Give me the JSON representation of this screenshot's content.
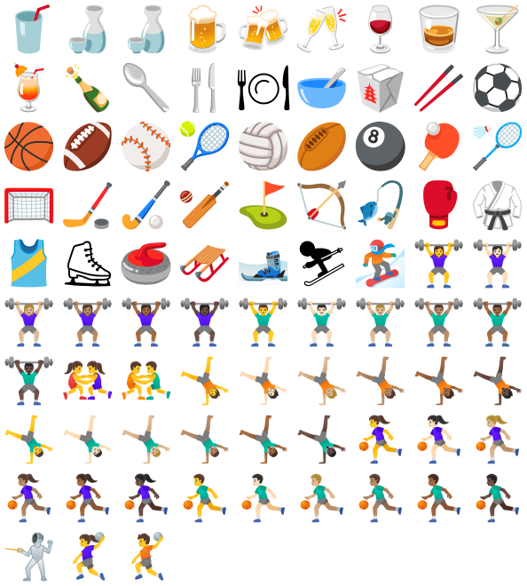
{
  "emojis": [
    {
      "name": "cup-with-straw-icon",
      "glyph": "🥤"
    },
    {
      "name": "sake-cup-icon",
      "glyph": "🍶"
    },
    {
      "name": "sake-bottle-icon",
      "glyph": "🍶"
    },
    {
      "name": "beer-mug-icon",
      "glyph": "🍺"
    },
    {
      "name": "clinking-beer-mugs-icon",
      "glyph": "🍻"
    },
    {
      "name": "clinking-glasses-icon",
      "glyph": "🥂"
    },
    {
      "name": "wine-glass-icon",
      "glyph": "🍷"
    },
    {
      "name": "tumbler-glass-icon",
      "glyph": "🥃"
    },
    {
      "name": "cocktail-glass-icon",
      "glyph": "🍸"
    },
    {
      "name": "tropical-drink-icon",
      "glyph": "🍹"
    },
    {
      "name": "champagne-bottle-icon",
      "glyph": "🍾"
    },
    {
      "name": "spoon-icon",
      "glyph": "🥄"
    },
    {
      "name": "fork-and-knife-icon",
      "glyph": "🍴"
    },
    {
      "name": "fork-and-knife-with-plate-icon",
      "glyph": "🍽"
    },
    {
      "name": "bowl-with-soup-icon",
      "glyph": "🥣"
    },
    {
      "name": "takeout-box-icon",
      "glyph": "🥡"
    },
    {
      "name": "chopsticks-icon",
      "glyph": "🥢"
    },
    {
      "name": "soccer-ball-icon",
      "glyph": "⚽"
    },
    {
      "name": "basketball-icon",
      "glyph": "🏀"
    },
    {
      "name": "american-football-icon",
      "glyph": "🏈"
    },
    {
      "name": "baseball-icon",
      "glyph": "⚾"
    },
    {
      "name": "tennis-icon",
      "glyph": "🎾"
    },
    {
      "name": "volleyball-icon",
      "glyph": "🏐"
    },
    {
      "name": "rugby-football-icon",
      "glyph": "🏉"
    },
    {
      "name": "pool-8-ball-icon",
      "glyph": "🎱"
    },
    {
      "name": "ping-pong-icon",
      "glyph": "🏓"
    },
    {
      "name": "badminton-icon",
      "glyph": "🏸"
    },
    {
      "name": "goal-net-icon",
      "glyph": "🥅"
    },
    {
      "name": "ice-hockey-icon",
      "glyph": "🏒"
    },
    {
      "name": "field-hockey-icon",
      "glyph": "🏑"
    },
    {
      "name": "cricket-game-icon",
      "glyph": "🏏"
    },
    {
      "name": "flag-in-hole-icon",
      "glyph": "⛳"
    },
    {
      "name": "bow-and-arrow-icon",
      "glyph": "🏹"
    },
    {
      "name": "fishing-pole-icon",
      "glyph": "🎣"
    },
    {
      "name": "boxing-glove-icon",
      "glyph": "🥊"
    },
    {
      "name": "martial-arts-uniform-icon",
      "glyph": "🥋"
    },
    {
      "name": "running-shirt-icon",
      "glyph": "🎽"
    },
    {
      "name": "ice-skate-icon",
      "glyph": "⛸"
    },
    {
      "name": "curling-stone-icon",
      "glyph": "🥌"
    },
    {
      "name": "sled-icon",
      "glyph": "🛷"
    },
    {
      "name": "skis-icon",
      "glyph": "🎿"
    },
    {
      "name": "skier-icon",
      "glyph": "⛷"
    },
    {
      "name": "snowboarder-icon",
      "glyph": "🏂"
    },
    {
      "name": "woman-lifting-weights-icon",
      "glyph": "🏋️‍♀️"
    },
    {
      "name": "woman-lifting-weights-light-skin-icon",
      "glyph": "🏋🏻‍♀️"
    },
    {
      "name": "woman-lifting-weights-medium-light-skin-icon",
      "glyph": "🏋🏼‍♀️"
    },
    {
      "name": "woman-lifting-weights-medium-skin-icon",
      "glyph": "🏋🏽‍♀️"
    },
    {
      "name": "woman-lifting-weights-medium-dark-skin-icon",
      "glyph": "🏋🏾‍♀️"
    },
    {
      "name": "woman-lifting-weights-dark-skin-icon",
      "glyph": "🏋🏿‍♀️"
    },
    {
      "name": "man-lifting-weights-icon",
      "glyph": "🏋️‍♂️"
    },
    {
      "name": "man-lifting-weights-light-skin-icon",
      "glyph": "🏋🏻‍♂️"
    },
    {
      "name": "man-lifting-weights-medium-light-skin-icon",
      "glyph": "🏋🏼‍♂️"
    },
    {
      "name": "man-lifting-weights-medium-skin-icon",
      "glyph": "🏋🏽‍♂️"
    },
    {
      "name": "man-lifting-weights-medium-dark-skin-icon",
      "glyph": "🏋🏾‍♂️"
    },
    {
      "name": "man-lifting-weights-dark-skin-icon",
      "glyph": "🏋🏿‍♂️"
    },
    {
      "name": "women-wrestling-icon",
      "glyph": "🤼‍♀️"
    },
    {
      "name": "men-wrestling-icon",
      "glyph": "🤼‍♂️"
    },
    {
      "name": "person-cartwheeling-icon",
      "glyph": "🤸"
    },
    {
      "name": "person-cartwheeling-light-skin-icon",
      "glyph": "🤸🏻"
    },
    {
      "name": "person-cartwheeling-medium-light-skin-icon",
      "glyph": "🤸🏼"
    },
    {
      "name": "person-cartwheeling-medium-skin-icon",
      "glyph": "🤸🏽"
    },
    {
      "name": "person-cartwheeling-medium-dark-skin-icon",
      "glyph": "🤸🏾"
    },
    {
      "name": "person-cartwheeling-dark-skin-icon",
      "glyph": "🤸🏿"
    },
    {
      "name": "man-cartwheeling-icon",
      "glyph": "🤸‍♂️"
    },
    {
      "name": "man-cartwheeling-light-skin-icon",
      "glyph": "🤸🏻‍♂️"
    },
    {
      "name": "man-cartwheeling-medium-light-skin-icon",
      "glyph": "🤸🏼‍♂️"
    },
    {
      "name": "man-cartwheeling-medium-skin-icon",
      "glyph": "🤸🏽‍♂️"
    },
    {
      "name": "man-cartwheeling-medium-dark-skin-icon",
      "glyph": "🤸🏾‍♂️"
    },
    {
      "name": "man-cartwheeling-dark-skin-icon",
      "glyph": "🤸🏿‍♂️"
    },
    {
      "name": "woman-bouncing-ball-icon",
      "glyph": "⛹️‍♀️"
    },
    {
      "name": "woman-bouncing-ball-light-skin-icon",
      "glyph": "⛹🏻‍♀️"
    },
    {
      "name": "woman-bouncing-ball-medium-light-skin-icon",
      "glyph": "⛹🏼‍♀️"
    },
    {
      "name": "woman-bouncing-ball-medium-skin-icon",
      "glyph": "⛹🏽‍♀️"
    },
    {
      "name": "woman-bouncing-ball-medium-dark-skin-icon",
      "glyph": "⛹🏾‍♀️"
    },
    {
      "name": "woman-bouncing-ball-dark-skin-icon",
      "glyph": "⛹🏿‍♀️"
    },
    {
      "name": "man-bouncing-ball-icon",
      "glyph": "⛹️‍♂️"
    },
    {
      "name": "man-bouncing-ball-light-skin-icon",
      "glyph": "⛹🏻‍♂️"
    },
    {
      "name": "man-bouncing-ball-medium-light-skin-icon",
      "glyph": "⛹🏼‍♂️"
    },
    {
      "name": "man-bouncing-ball-medium-skin-icon",
      "glyph": "⛹🏽‍♂️"
    },
    {
      "name": "man-bouncing-ball-medium-dark-skin-icon",
      "glyph": "⛹🏾‍♂️"
    },
    {
      "name": "man-bouncing-ball-dark-skin-icon",
      "glyph": "⛹🏿‍♂️"
    },
    {
      "name": "person-fencing-icon",
      "glyph": "🤺"
    },
    {
      "name": "woman-playing-handball-icon",
      "glyph": "🤾‍♀️"
    },
    {
      "name": "person-playing-handball-icon",
      "glyph": "🤾"
    }
  ]
}
